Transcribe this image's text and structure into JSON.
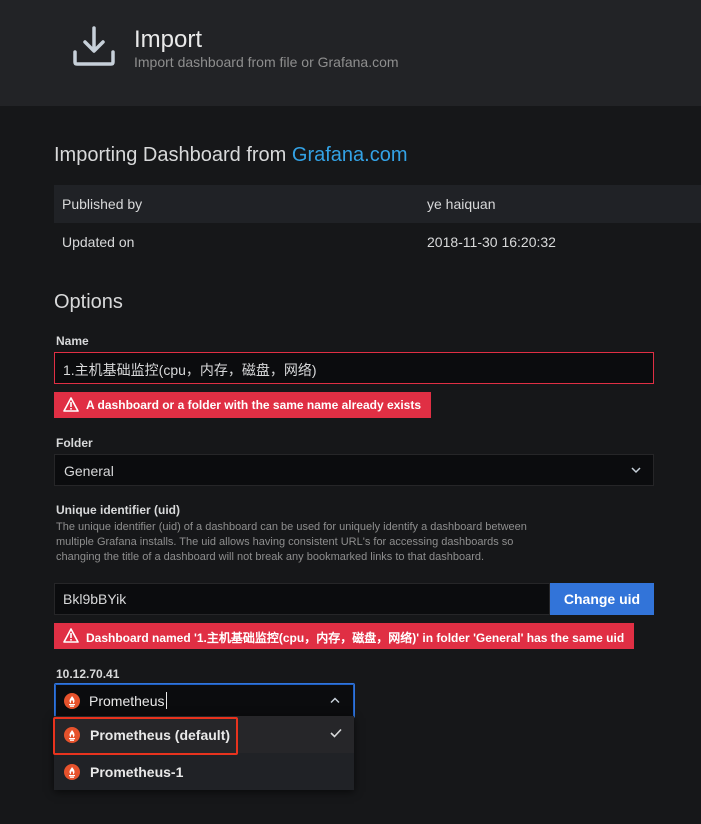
{
  "header": {
    "title": "Import",
    "subtitle": "Import dashboard from file or Grafana.com",
    "icon": "download-icon"
  },
  "importing": {
    "title_prefix": "Importing Dashboard from ",
    "title_link": "Grafana.com",
    "rows": [
      {
        "key": "Published by",
        "value": "ye haiquan"
      },
      {
        "key": "Updated on",
        "value": "2018-11-30 16:20:32"
      }
    ]
  },
  "options": {
    "title": "Options",
    "name": {
      "label": "Name",
      "value": "1.主机基础监控(cpu，内存，磁盘，网络)",
      "error": "A dashboard or a folder with the same name already exists"
    },
    "folder": {
      "label": "Folder",
      "value": "General"
    },
    "uid": {
      "label": "Unique identifier (uid)",
      "description": "The unique identifier (uid) of a dashboard can be used for uniquely identify a dashboard between multiple Grafana installs. The uid allows having consistent URL's for accessing dashboards so changing the title of a dashboard will not break any bookmarked links to that dashboard.",
      "value": "Bkl9bBYik",
      "button": "Change uid",
      "error": "Dashboard named '1.主机基础监控(cpu，内存，磁盘，网络)' in folder 'General' has the same uid"
    },
    "datasource": {
      "label": "10.12.70.41",
      "input_value": "Prometheus",
      "options": [
        {
          "label": "Prometheus (default)",
          "selected": true
        },
        {
          "label": "Prometheus-1",
          "selected": false
        }
      ]
    }
  },
  "colors": {
    "error": "#e02f44",
    "accent": "#3274d9",
    "link": "#33a2e5",
    "highlight": "#e8331e",
    "prometheus": "#e6522c"
  }
}
